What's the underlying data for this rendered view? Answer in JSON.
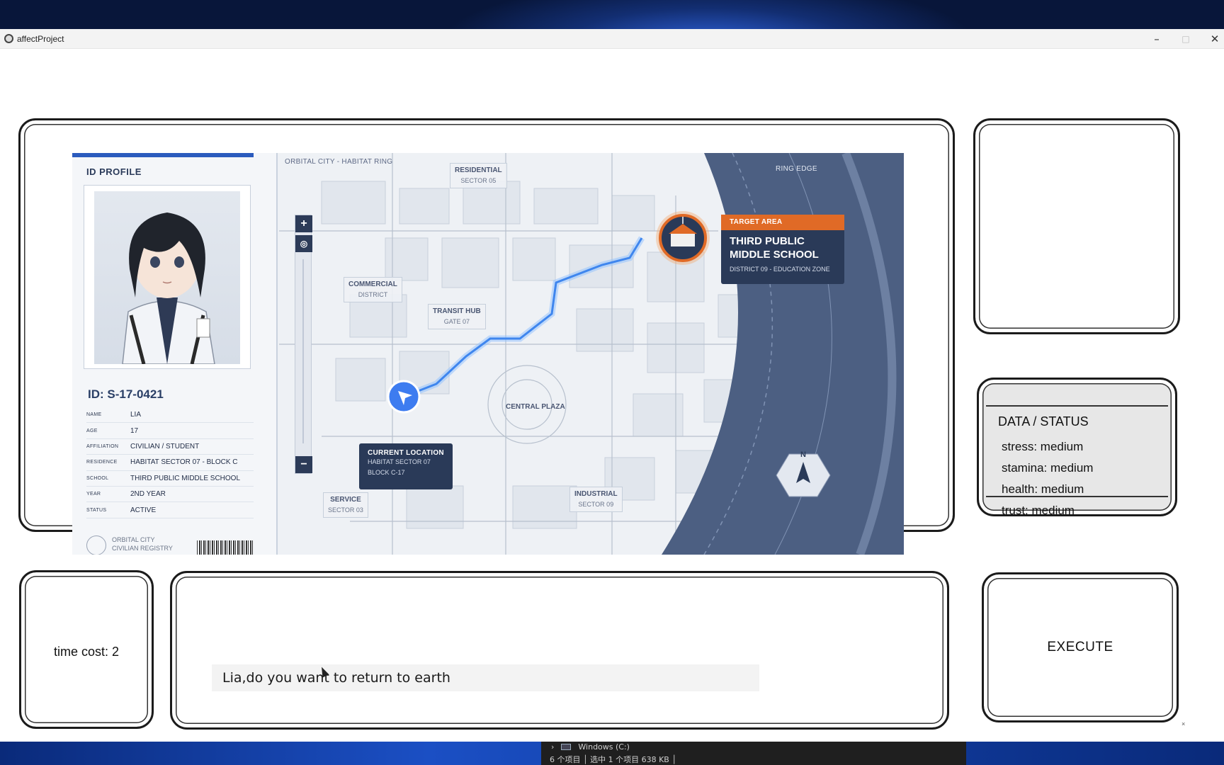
{
  "window": {
    "title": "affectProject",
    "minimize": "–",
    "maximize": "□",
    "close": "✕"
  },
  "id_card": {
    "heading": "ID PROFILE",
    "id_number": "ID: S-17-0421",
    "rows": [
      {
        "key": "NAME",
        "value": "LIA"
      },
      {
        "key": "AGE",
        "value": "17"
      },
      {
        "key": "AFFILIATION",
        "value": "CIVILIAN / STUDENT"
      },
      {
        "key": "RESIDENCE",
        "value": "HABITAT SECTOR 07 - BLOCK C"
      },
      {
        "key": "SCHOOL",
        "value": "THIRD PUBLIC MIDDLE SCHOOL"
      },
      {
        "key": "YEAR",
        "value": "2ND YEAR"
      },
      {
        "key": "STATUS",
        "value": "ACTIVE"
      }
    ],
    "registry_line1": "ORBITAL CITY",
    "registry_line2": "CIVILIAN REGISTRY"
  },
  "map": {
    "caption": "ORBITAL CITY - HABITAT RING",
    "ring_edge": "RING EDGE",
    "zoom_in": "+",
    "zoom_locate": "◎",
    "zoom_out": "−",
    "labels": {
      "residential": {
        "name": "RESIDENTIAL",
        "sub": "SECTOR 05"
      },
      "commercial": {
        "name": "COMMERCIAL",
        "sub": "DISTRICT"
      },
      "transit": {
        "name": "TRANSIT HUB",
        "sub": "GATE 07"
      },
      "central": {
        "name": "CENTRAL PLAZA"
      },
      "service": {
        "name": "SERVICE",
        "sub": "SECTOR 03"
      },
      "industrial": {
        "name": "INDUSTRIAL",
        "sub": "SECTOR 09"
      }
    },
    "current_location": {
      "title": "CURRENT LOCATION",
      "line1": "HABITAT SECTOR 07",
      "line2": "BLOCK C-17"
    },
    "target": {
      "header": "TARGET AREA",
      "name_line1": "THIRD PUBLIC",
      "name_line2": "MIDDLE SCHOOL",
      "sub": "DISTRICT 09 - EDUCATION ZONE"
    },
    "compass": "N"
  },
  "status": {
    "title": "DATA / STATUS",
    "lines": [
      "stress: medium",
      "stamina: medium",
      "health: medium",
      "trust: medium"
    ]
  },
  "time_cost": "time cost: 2",
  "input": {
    "value": "Lia,do you want to return to earth"
  },
  "execute_label": "EXECUTE",
  "corner_mark": "×",
  "explorer": {
    "drive": "Windows (C:)",
    "status": "6 个项目  │  选中 1 个项目  638 KB  │"
  },
  "colors": {
    "accent_orange": "#e06a26",
    "route_blue": "#5aa0ff",
    "card_navy": "#2a3a58"
  }
}
